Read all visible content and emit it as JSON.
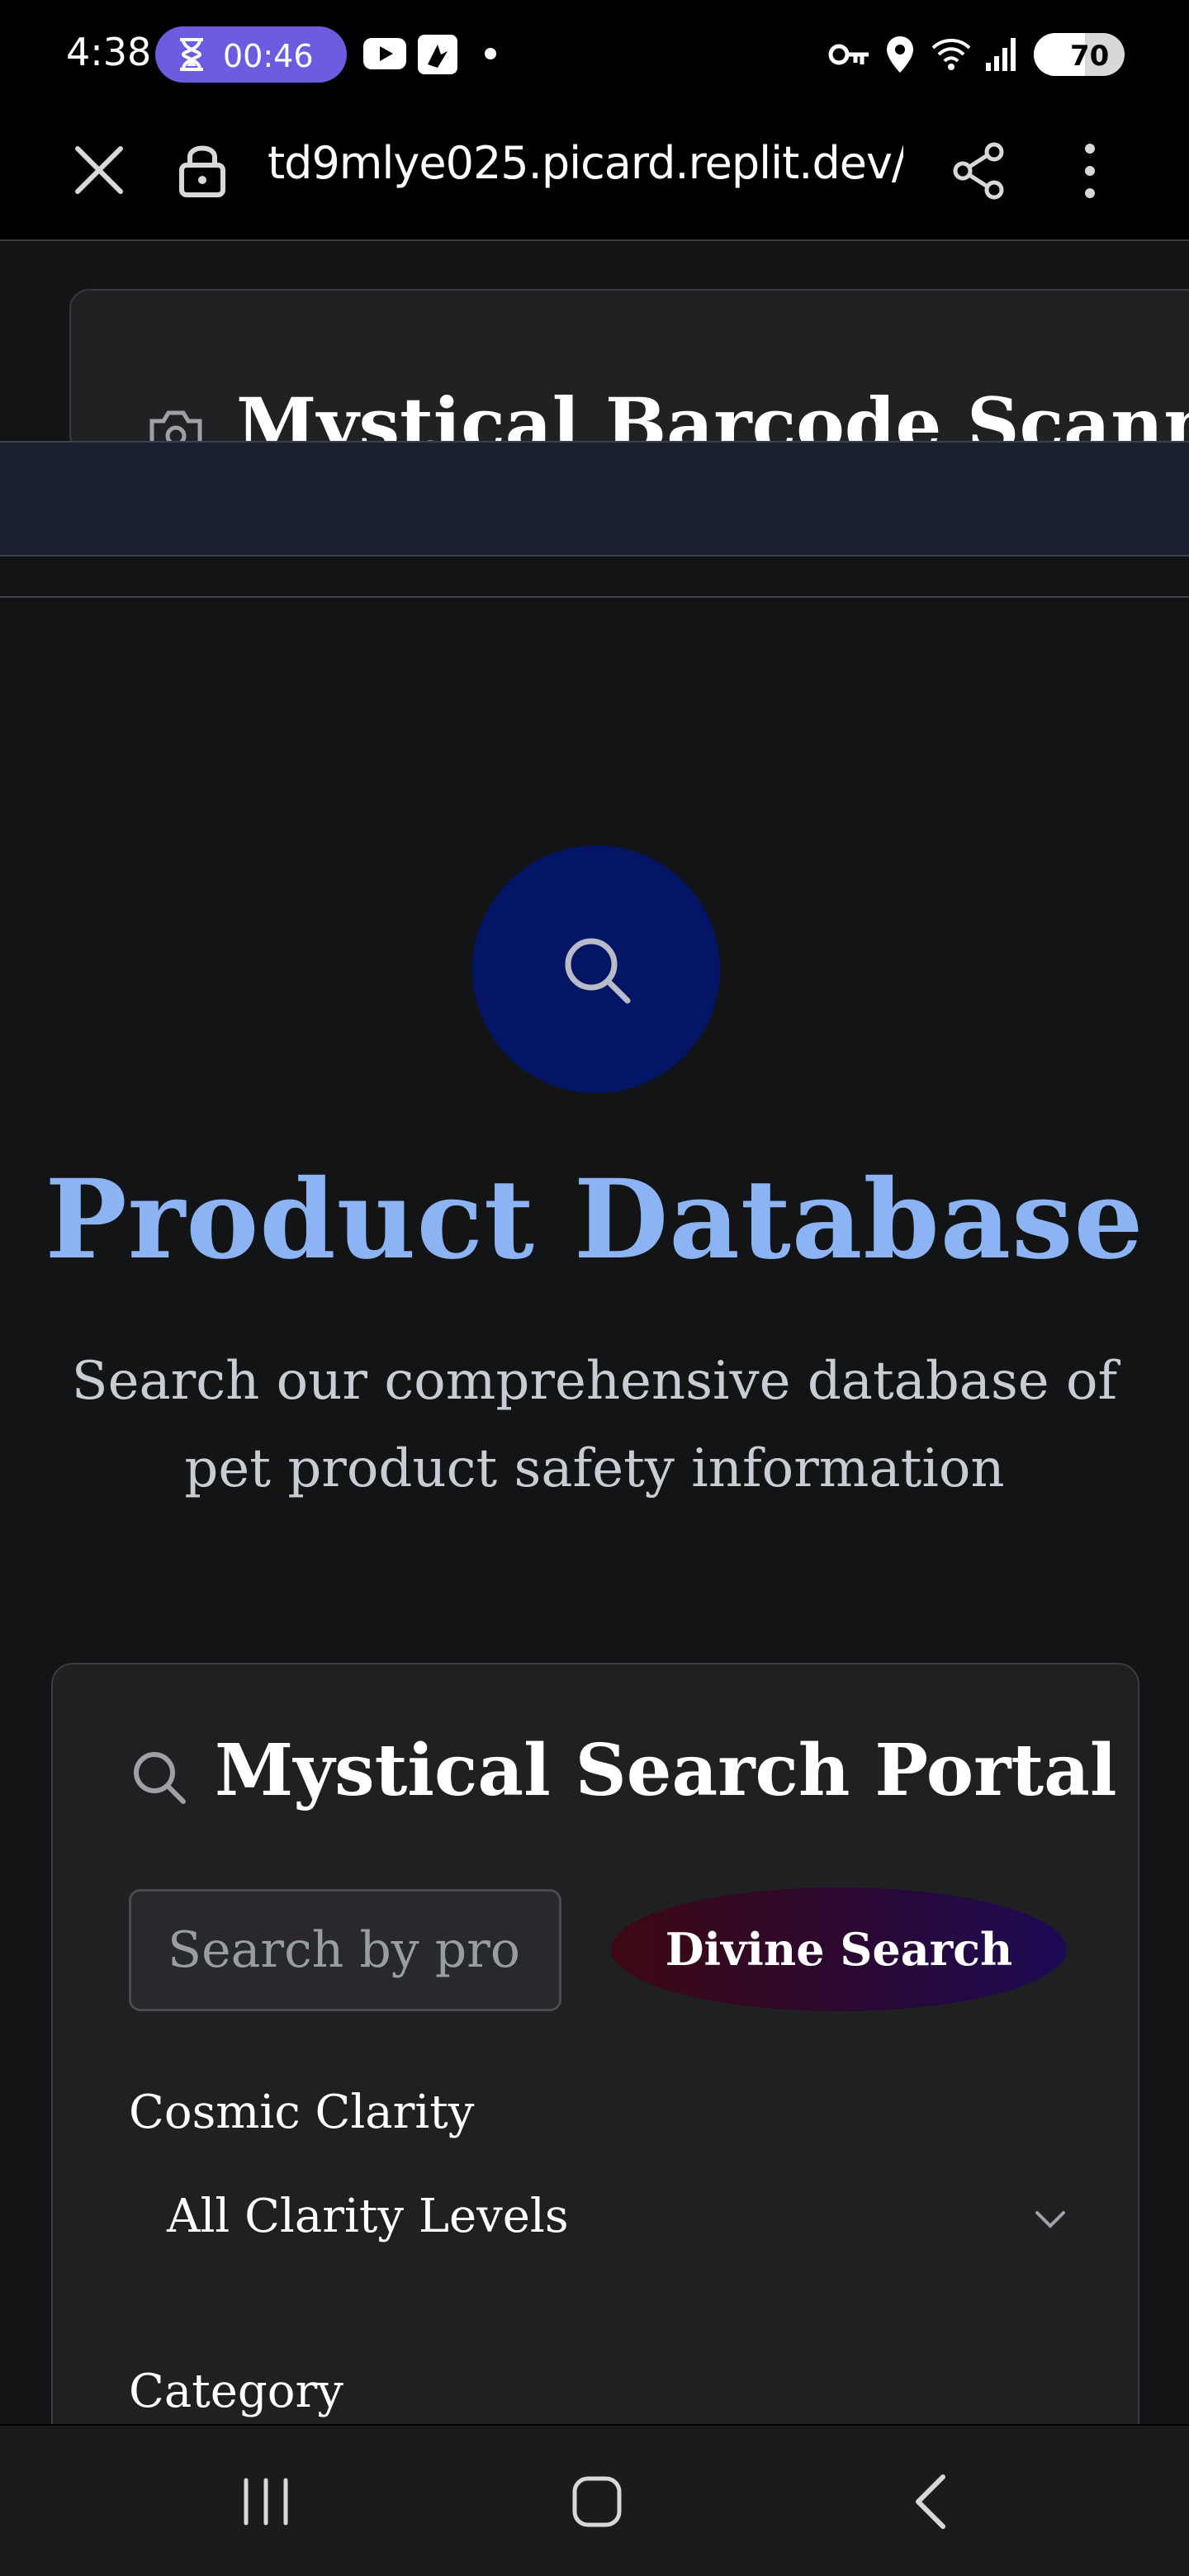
{
  "status_bar": {
    "time": "4:38",
    "timer": "00:46",
    "battery": "70",
    "icons": [
      "hourglass-icon",
      "youtube-icon",
      "app-icon",
      "dot-icon",
      "key-icon",
      "location-icon",
      "wifi-icon",
      "signal-icon",
      "battery-icon"
    ]
  },
  "browser": {
    "url": "td9mlye025.picard.replit.dev/",
    "icons": [
      "close-icon",
      "lock-icon",
      "share-icon",
      "more-icon"
    ]
  },
  "scrolled_header": {
    "title": "Mystical Barcode Scanner"
  },
  "hero": {
    "title": "Product Database",
    "subtitle": "Search our comprehensive database of pet product safety information",
    "title_color": "#8cb4f5",
    "circle_color": "#041566"
  },
  "search_card": {
    "title": "Mystical Search Portal",
    "search_placeholder": "Search by prod",
    "search_button": "Divine Search",
    "clarity_label": "Cosmic Clarity",
    "clarity_value": "All Clarity Levels",
    "category_label": "Category"
  },
  "nav_bar": {
    "icons": [
      "recents-icon",
      "home-icon",
      "back-icon"
    ]
  }
}
